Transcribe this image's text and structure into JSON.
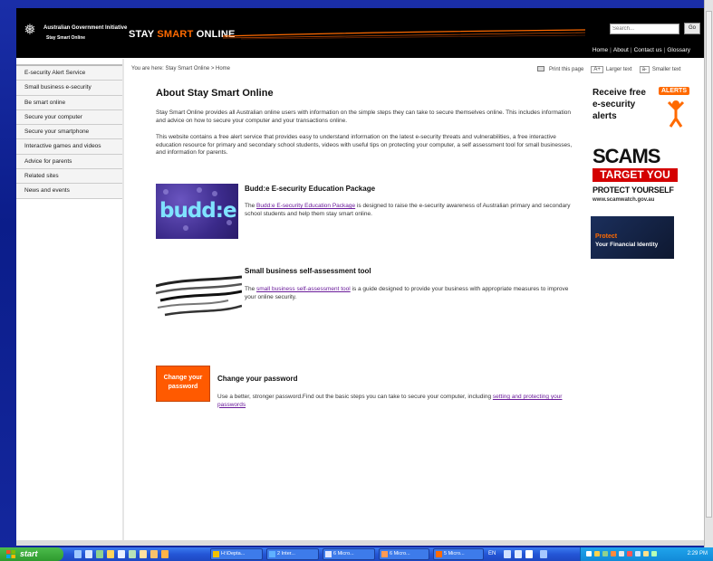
{
  "header": {
    "gov_line1": "Australian Government Initiative",
    "gov_line2": "Stay Smart Online",
    "logo_part1": "STAY ",
    "logo_part2": "SMART",
    "logo_part3": " ONLINE",
    "search_placeholder": "Search...",
    "go_label": "Go",
    "links": [
      "Home",
      "About",
      "Contact us",
      "Glossary"
    ]
  },
  "sidebar": {
    "items": [
      "E-security Alert Service",
      "Small business e-security",
      "Be smart online",
      "Secure your computer",
      "Secure your smartphone",
      "Interactive games and videos",
      "Advice for parents",
      "Related sites",
      "News and events"
    ]
  },
  "breadcrumb": "You are here: Stay Smart Online > Home",
  "utility": {
    "print_label": "Print this page",
    "larger_box": "A+",
    "larger_label": "Larger text",
    "smaller_box": "a-",
    "smaller_label": "Smaller text"
  },
  "main": {
    "title": "About Stay Smart Online",
    "intro_1": "Stay Smart Online provides all Australian online users with information on the simple steps they can take to secure themselves online. This includes information and advice on how to secure your computer and your transactions online.",
    "intro_2": "This website contains a free alert service that provides easy to understand information on the latest e-security threats and vulnerabilities, a free interactive education resource for primary and secondary school students, videos with useful tips on protecting your computer, a self assessment tool for small businesses, and information for parents.",
    "budd": {
      "thumb_text": "budd:e",
      "heading": "Budd:e E-security Education Package",
      "text_before": "The ",
      "link": "Budd:e E-security Education Package",
      "text_after": " is designed to raise the e-security awareness of Australian primary and secondary school students and help them stay smart online."
    },
    "small_business": {
      "heading": "Small business self-assessment tool",
      "text_before": "The ",
      "link": "small business self-assessment tool",
      "text_after": " is a guide designed to provide your business with appropriate measures to improve your online security."
    },
    "password": {
      "thumb_line1": "Change your",
      "thumb_line2": "password",
      "heading": "Change your password",
      "text_before": "Use a better, stronger password.Find out the basic steps you can take to secure your computer, including ",
      "link": "setting and protecting your passwords"
    }
  },
  "promos": {
    "alerts_line1": "Receive free",
    "alerts_badge": "ALERTS",
    "alerts_line2": "e-security",
    "alerts_line3": "alerts",
    "scams_title": "SCAMS",
    "scams_target": "TARGET YOU",
    "scams_protect": "PROTECT YOURSELF",
    "scams_url": "www.scamwatch.gov.au",
    "protect_line1": "Protect",
    "protect_line2": "Your Financial Identity"
  },
  "taskbar": {
    "start_label": "start",
    "tasks": [
      "H:\\Depta...",
      "2 Inter...",
      "6 Micro...",
      "6 Micro...",
      "5 Micro..."
    ],
    "lang": "EN",
    "clock": "2:29 PM"
  },
  "colors": {
    "accent_orange": "#ff6a00",
    "header_black": "#000000",
    "link_purple": "#6a1b9a",
    "desktop_blue": "#0b1d8a"
  }
}
